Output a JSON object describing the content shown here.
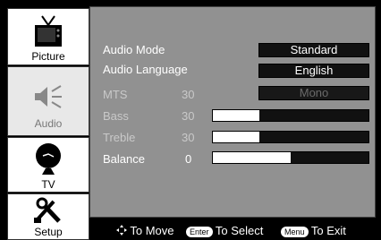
{
  "sidebar": {
    "items": [
      {
        "label": "Picture",
        "icon": "tv-icon"
      },
      {
        "label": "Audio",
        "icon": "speaker-icon"
      },
      {
        "label": "TV",
        "icon": "satellite-dish-icon"
      },
      {
        "label": "Setup",
        "icon": "tools-icon"
      }
    ]
  },
  "menu": {
    "audio_mode": {
      "label": "Audio Mode",
      "value": "Standard"
    },
    "audio_language": {
      "label": "Audio Language",
      "value": "English"
    },
    "mts": {
      "label": "MTS",
      "number": "30",
      "value": "Mono"
    },
    "bass": {
      "label": "Bass",
      "number": "30",
      "level": 0.3
    },
    "treble": {
      "label": "Treble",
      "number": "30",
      "level": 0.3
    },
    "balance": {
      "label": "Balance",
      "number": "0",
      "level": 0.5
    }
  },
  "footer": {
    "move": "To Move",
    "enter_key": "Enter",
    "select": "To Select",
    "menu_key": "Menu",
    "exit": "To Exit"
  },
  "colors": {
    "panel": "#919191",
    "background": "#000000",
    "active_text": "#ffffff",
    "inactive_text": "#c9c9c9"
  }
}
